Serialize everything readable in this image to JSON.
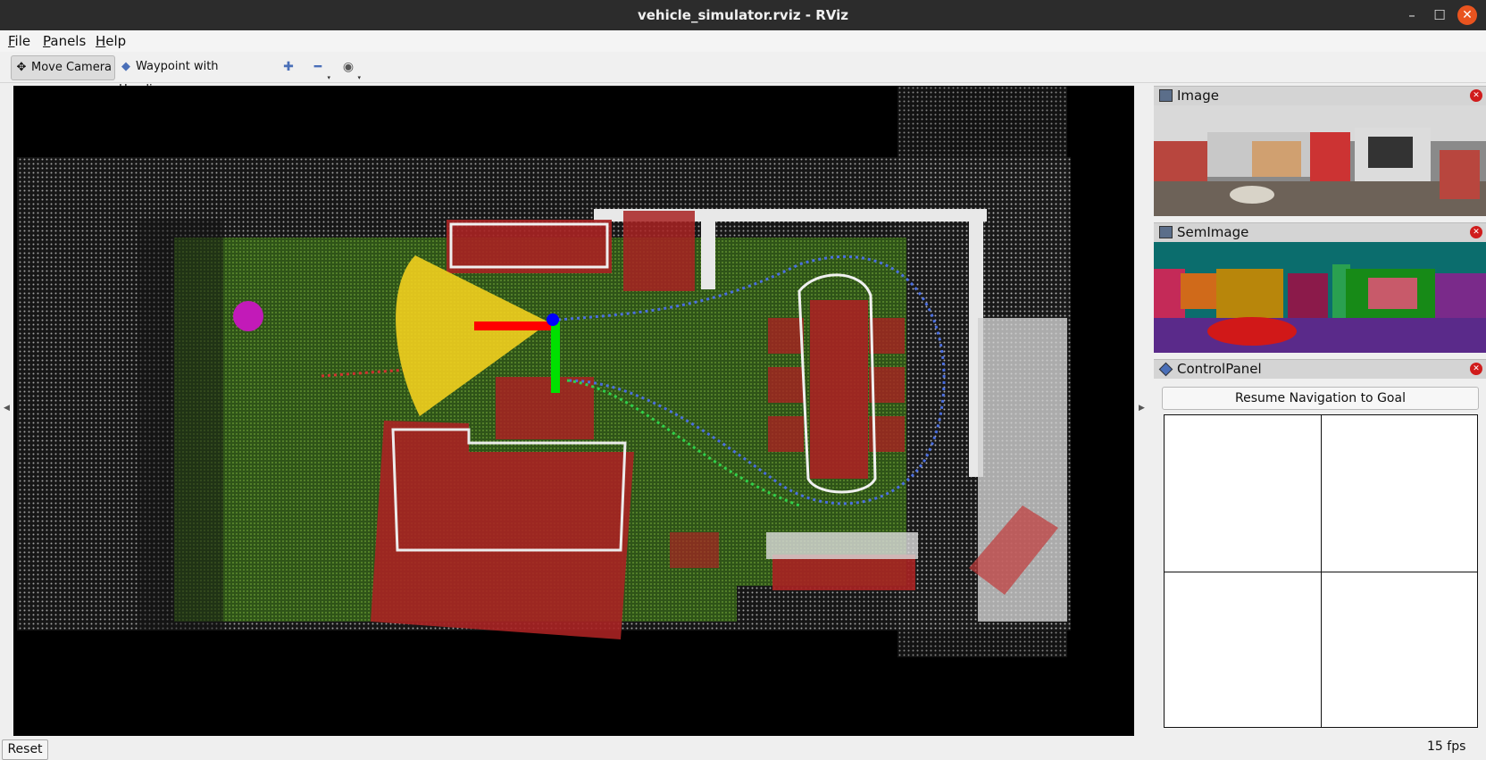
{
  "window": {
    "title": "vehicle_simulator.rviz - RViz"
  },
  "menu": {
    "items": [
      "File",
      "Panels",
      "Help"
    ]
  },
  "toolbar": {
    "move_camera": "Move Camera",
    "waypoint": "Waypoint with Heading",
    "icons": [
      "plus-icon",
      "minus-icon",
      "eye-icon"
    ]
  },
  "panels": {
    "image": {
      "title": "Image"
    },
    "semimage": {
      "title": "SemImage"
    },
    "controlpanel": {
      "title": "ControlPanel",
      "button": "Resume Navigation to Goal"
    }
  },
  "status": {
    "reset": "Reset",
    "fps": "15 fps"
  },
  "colors": {
    "grid_green": "#3e6a1f",
    "obstacle_red": "#a82222",
    "laser_yellow": "#f2cf1e",
    "axis_x": "#ff0000",
    "axis_y": "#00ff00",
    "axis_z": "#0000ff",
    "goal_magenta": "#c21ab8"
  }
}
